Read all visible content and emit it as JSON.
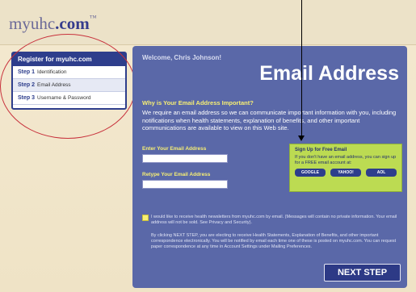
{
  "header": {
    "logo_main": "myuhc",
    "logo_suffix": ".com",
    "logo_tm": "™"
  },
  "steps": {
    "title": "Register for myuhc.com",
    "items": [
      {
        "num": "Step 1",
        "label": "Identification"
      },
      {
        "num": "Step 2",
        "label": "Email Address"
      },
      {
        "num": "Step 3",
        "label": "Username & Password"
      }
    ]
  },
  "main": {
    "welcome": "Welcome, Chris Johnson!",
    "title": "Email Address",
    "why_title": "Why is Your Email Address Important?",
    "why_body": "We require an email address so we can communicate important information with you, including notifications when health statements, explanation of benefits, and other important communications are available to view on this Web site.",
    "email_label": "Enter Your Email Address",
    "retype_label": "Retype Your Email Address",
    "email_value": "",
    "retype_value": ""
  },
  "signup": {
    "title": "Sign Up for Free Email",
    "body": "If you don't have an email address, you can sign up for a FREE email account at:",
    "providers": [
      "GOOGLE",
      "YAHOO!",
      "AOL"
    ]
  },
  "newsletter_text": "I would like to receive health newsletters from myuhc.com by email. (Messages will contain no private information. Your email address will not be sold. See Privacy and Security).",
  "legal_text": "By clicking NEXT STEP, you are electing to receive Health Statements, Explanation of Benefits, and other important correspondence electronically. You will be notified by email each time one of these is posted on myuhc.com. You can request paper correspondence at any time in Account Settings under Mailing Preferences.",
  "next_button": "NEXT STEP",
  "colors": {
    "panel": "#5a68a8",
    "accent_yellow": "#f7ef74",
    "signup_green": "#bcdb52",
    "nav_blue": "#2e3e8c",
    "annotation_red": "#c8313c"
  }
}
